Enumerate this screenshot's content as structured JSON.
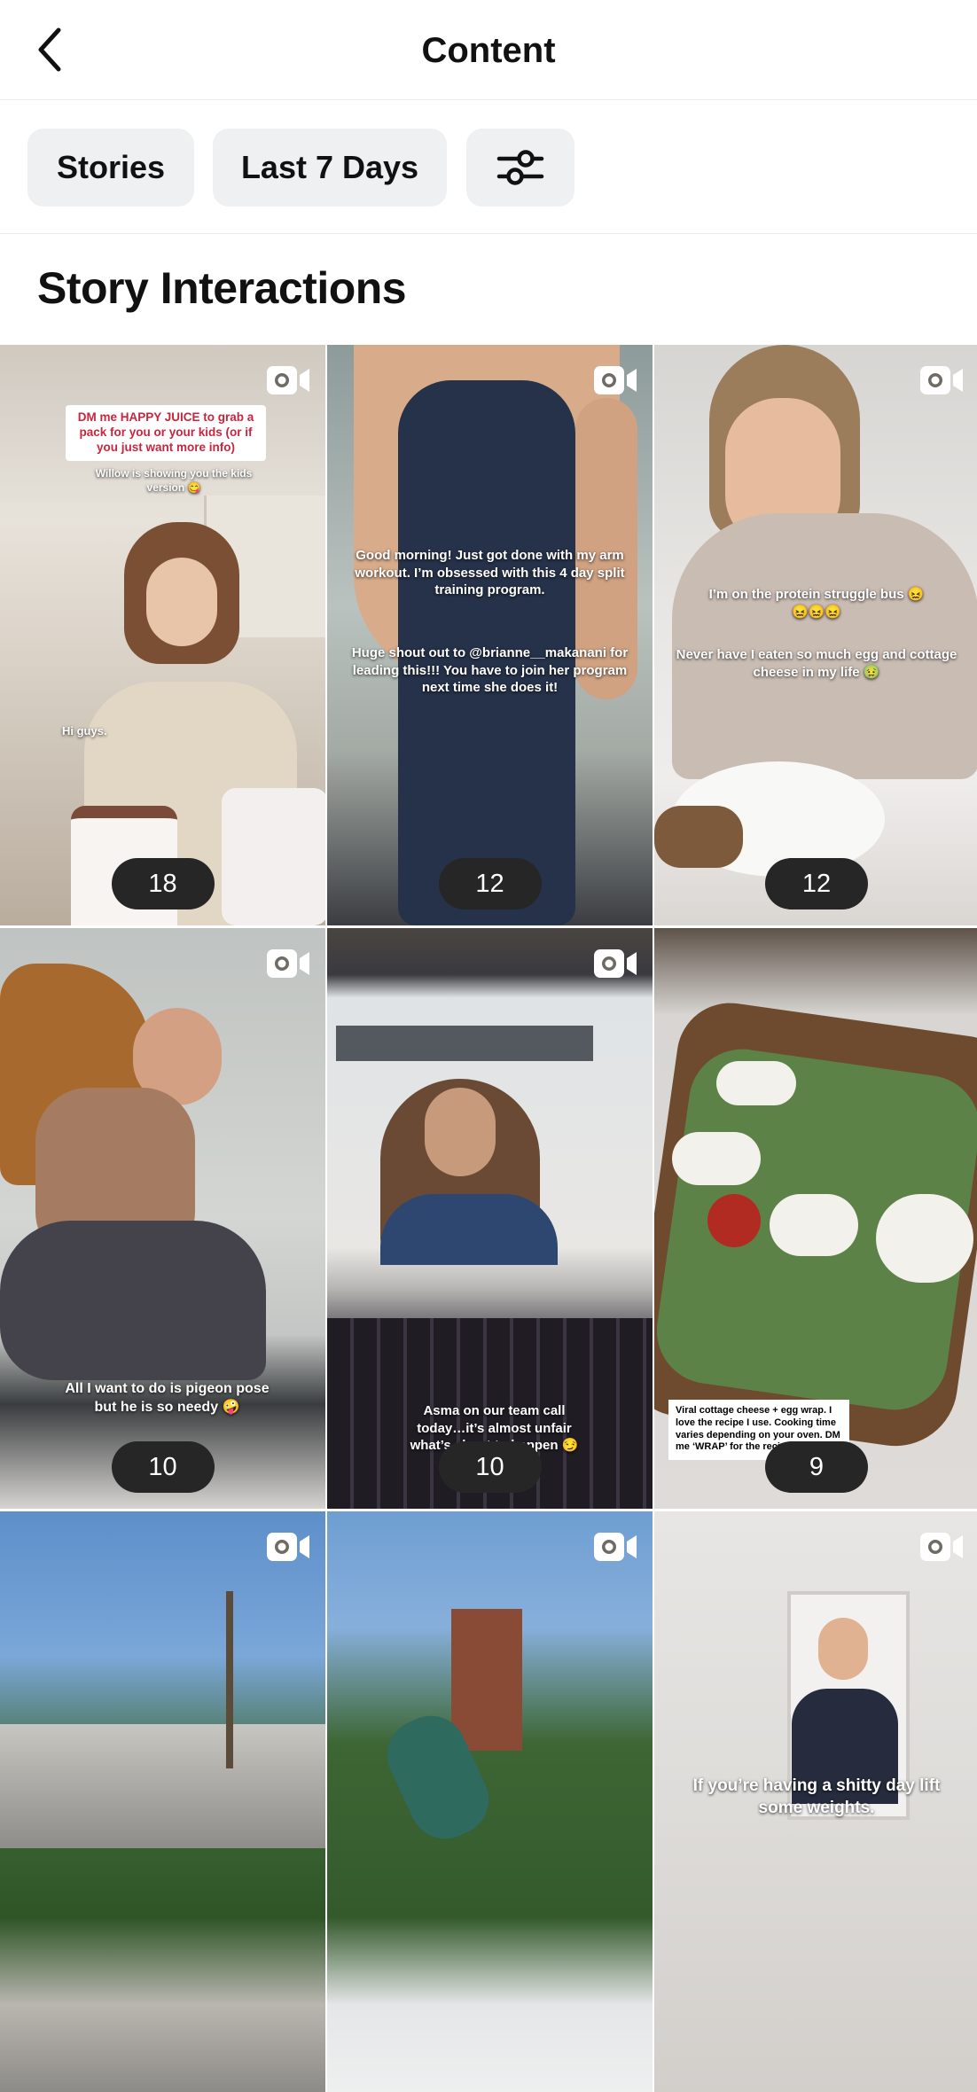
{
  "header": {
    "title": "Content"
  },
  "filters": {
    "stories_label": "Stories",
    "range_label": "Last 7 Days"
  },
  "section": {
    "title": "Story Interactions"
  },
  "tiles": [
    {
      "count": "18",
      "caption_pill": "DM me HAPPY JUICE to grab a pack for you or your kids (or if you just want more info)",
      "caption": "Willow is showing you the kids version 😋",
      "caption2": "Hi guys."
    },
    {
      "count": "12",
      "caption": "Good morning! Just got done with my arm workout. I’m obsessed with this 4 day split training program.",
      "caption2": "Huge shout out to @brianne__makanani for leading this!!! You have to join her program next time she does it!"
    },
    {
      "count": "12",
      "caption": "I’m on the protein struggle bus 😖😖😖😖",
      "caption2": "Never have I eaten so much egg and cottage cheese in my life 🤢"
    },
    {
      "count": "10",
      "caption": "All I want to do is pigeon pose but he is so needy 🤪"
    },
    {
      "count": "10",
      "caption": "Asma on our team call today…it’s almost unfair what’s about to happen 😏"
    },
    {
      "count": "9",
      "caption": "Viral cottage cheese + egg wrap. I love the recipe I use. Cooking time varies depending on your oven. DM me ‘WRAP’ for the recipe"
    },
    {
      "count": ""
    },
    {
      "count": ""
    },
    {
      "count": "",
      "caption": "If you’re having a shitty day lift some weights."
    }
  ],
  "icons": {
    "back": "chevron-left-icon",
    "filter": "sliders-icon",
    "video": "video-camera-icon"
  },
  "colors": {
    "chip_bg": "#eff0f2",
    "count_pill": "#262626"
  }
}
